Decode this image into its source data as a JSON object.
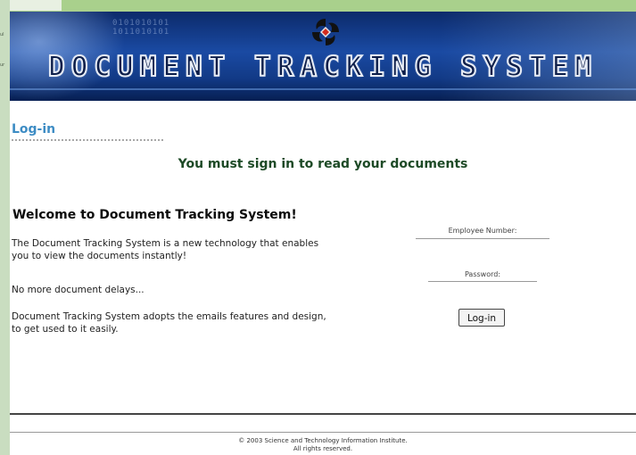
{
  "banner": {
    "title": "DOCUMENT TRACKING SYSTEM"
  },
  "login": {
    "heading": "Log-in",
    "signin_message": "You must sign in to read your documents",
    "employee_label": "Employee Number:",
    "password_label": "Password:",
    "button_label": "Log-in"
  },
  "welcome": {
    "title": "Welcome to Document Tracking System!",
    "paragraphs": [
      "The Document Tracking System is a new technology that enables you to view the documents instantly!",
      "No more document delays...",
      "Document Tracking System adopts the emails features and design, to get used to it easily."
    ]
  },
  "footer": {
    "line1": "© 2003 Science and Technology Information Institute.",
    "line2": "All rights reserved."
  },
  "colors": {
    "accent": "#3d8cc4",
    "signin_green": "#1d4a26",
    "banner_blue": "#1a4aa3",
    "side_green": "#cfe2c5"
  }
}
